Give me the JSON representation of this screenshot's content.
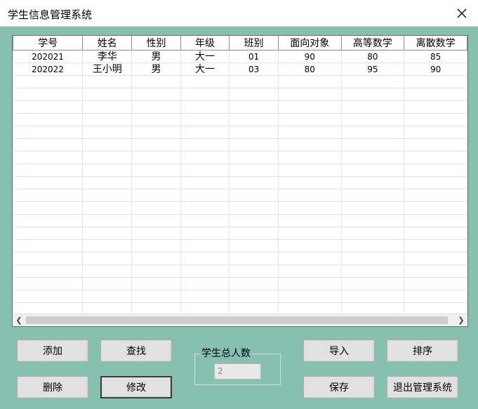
{
  "window": {
    "title": "学生信息管理系统"
  },
  "table": {
    "columns": [
      "学号",
      "姓名",
      "性别",
      "年级",
      "班别",
      "面向对象",
      "高等数学",
      "离散数学"
    ],
    "rows": [
      [
        "202021",
        "李华",
        "男",
        "大一",
        "01",
        "90",
        "80",
        "85"
      ],
      [
        "202022",
        "王小明",
        "男",
        "大一",
        "03",
        "80",
        "95",
        "90"
      ]
    ]
  },
  "buttons": {
    "add": "添加",
    "find": "查找",
    "delete": "删除",
    "modify": "修改",
    "import": "导入",
    "sort": "排序",
    "save": "保存",
    "exit": "退出管理系统"
  },
  "count_group": {
    "label": "学生总人数",
    "value": "2"
  },
  "icons": {
    "close": "close-icon",
    "scroll_left": "scroll-left-arrow-icon",
    "scroll_right": "scroll-right-arrow-icon"
  },
  "colors": {
    "background": "#88c0b0",
    "button": "#e1e1e1"
  }
}
